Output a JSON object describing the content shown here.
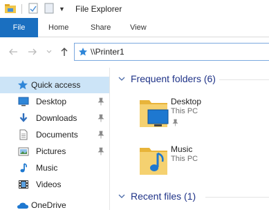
{
  "titlebar": {
    "title": "File Explorer"
  },
  "ribbon": {
    "tabs": [
      "File",
      "Home",
      "Share",
      "View"
    ]
  },
  "address": {
    "path": "\\\\Printer1"
  },
  "nav": {
    "items": [
      {
        "label": "Quick access",
        "icon": "star-icon",
        "selected": true
      },
      {
        "label": "Desktop",
        "icon": "desktop-icon",
        "pinned": true
      },
      {
        "label": "Downloads",
        "icon": "downloads-icon",
        "pinned": true
      },
      {
        "label": "Documents",
        "icon": "documents-icon",
        "pinned": true
      },
      {
        "label": "Pictures",
        "icon": "pictures-icon",
        "pinned": true
      },
      {
        "label": "Music",
        "icon": "music-icon"
      },
      {
        "label": "Videos",
        "icon": "videos-icon"
      },
      {
        "label": "OneDrive",
        "icon": "onedrive-icon"
      }
    ]
  },
  "content": {
    "frequent": {
      "title": "Frequent folders (6)",
      "tiles": [
        {
          "name": "Desktop",
          "sub": "This PC",
          "pinned": true
        },
        {
          "name": "Music",
          "sub": "This PC"
        }
      ]
    },
    "recent": {
      "title": "Recent files (1)"
    }
  },
  "colors": {
    "accent": "#1a6fc0",
    "selection": "#cce4f7",
    "group_heading": "#1e3287",
    "folder": "#f0c64a"
  }
}
